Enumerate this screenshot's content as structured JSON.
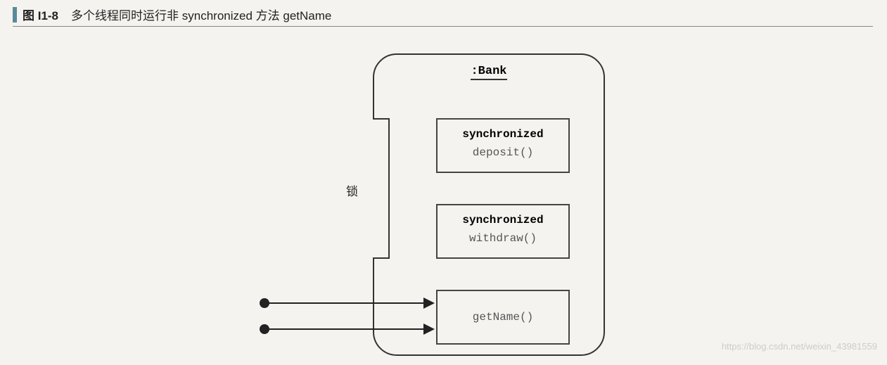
{
  "header": {
    "figure_label": "图 I1-8",
    "title": "多个线程同时运行非 synchronized 方法 getName"
  },
  "diagram": {
    "object_name": ":Bank",
    "lock_label": "锁",
    "methods": [
      {
        "sync": "synchronized",
        "name": "deposit()"
      },
      {
        "sync": "synchronized",
        "name": "withdraw()"
      },
      {
        "sync": null,
        "name": "getName()"
      }
    ]
  },
  "watermark": "https://blog.csdn.net/weixin_43981559"
}
